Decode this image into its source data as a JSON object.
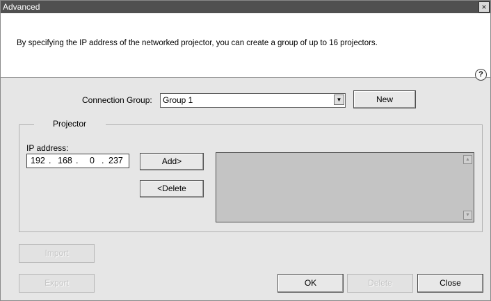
{
  "window": {
    "title": "Advanced",
    "close_glyph": "×"
  },
  "info": {
    "text": "By specifying the IP address of the networked projector, you can create a group of up to 16 projectors.",
    "help_glyph": "?"
  },
  "connection_group": {
    "label": "Connection Group:",
    "value": "Group 1",
    "new_label": "New"
  },
  "projector": {
    "legend": "Projector",
    "ip_label": "IP address:",
    "ip_octets": [
      "192",
      "168",
      "0",
      "237"
    ],
    "add_label": "Add>",
    "delete_label": "<Delete"
  },
  "buttons": {
    "import_label": "Import",
    "export_label": "Export",
    "ok_label": "OK",
    "delete_label": "Delete",
    "close_label": "Close"
  },
  "icons": {
    "help": "help-icon",
    "close": "close-icon",
    "dropdown": "chevron-down-icon"
  },
  "colors": {
    "titlebar": "#505050",
    "dialog": "#e6e6e6",
    "list_bg": "#c4c4c4"
  }
}
